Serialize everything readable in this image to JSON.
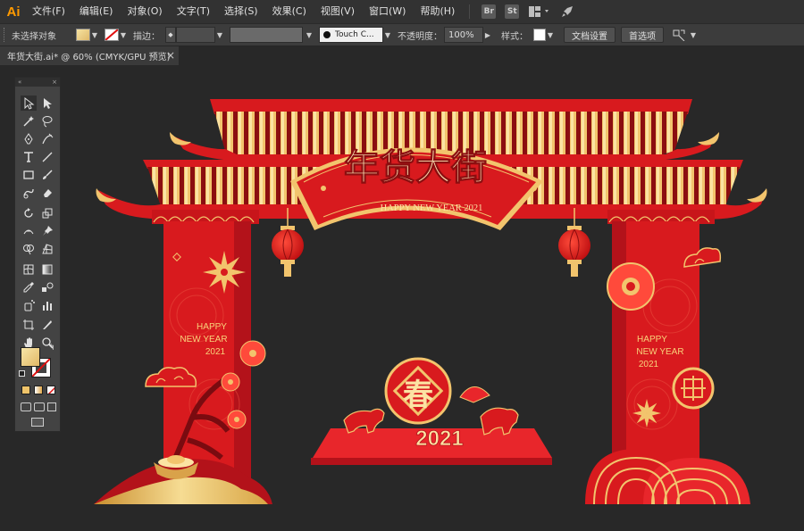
{
  "app": {
    "logo": "Ai"
  },
  "menu": [
    "文件(F)",
    "编辑(E)",
    "对象(O)",
    "文字(T)",
    "选择(S)",
    "效果(C)",
    "视图(V)",
    "窗口(W)",
    "帮助(H)"
  ],
  "menubar_icons": {
    "bridge": "Br",
    "stock": "St",
    "layout": "arrange-documents-icon",
    "gpu": "gpu-performance-rocket-icon"
  },
  "control": {
    "selection_label": "未选择对象",
    "stroke_label": "描边：",
    "brush_label": "Touch C...",
    "opacity_label": "不透明度：",
    "opacity_value": "100%",
    "style_label": "样式：",
    "doc_setup": "文档设置",
    "preferences": "首选项",
    "fill_color": "#f3d98a",
    "stroke_color": "#ffffff"
  },
  "tab": {
    "title": "年货大街.ai* @ 60% (CMYK/GPU 预览)",
    "close": "×"
  },
  "toolbar": {
    "collapse": "«",
    "close": "×"
  },
  "artwork": {
    "title": "年货大街",
    "banner_sub": "HAPPY NEW YEAR 2021",
    "pillar_left": [
      "HAPPY",
      "NEW YEAR",
      "2021"
    ],
    "pillar_right": [
      "HAPPY",
      "NEW YEAR",
      "2021"
    ],
    "center_char": "春",
    "year": "2021",
    "colors": {
      "red": "#d81a1e",
      "dark_red": "#8b0e10",
      "gold": "#f2c46d",
      "light_gold": "#fbe3a3"
    }
  }
}
